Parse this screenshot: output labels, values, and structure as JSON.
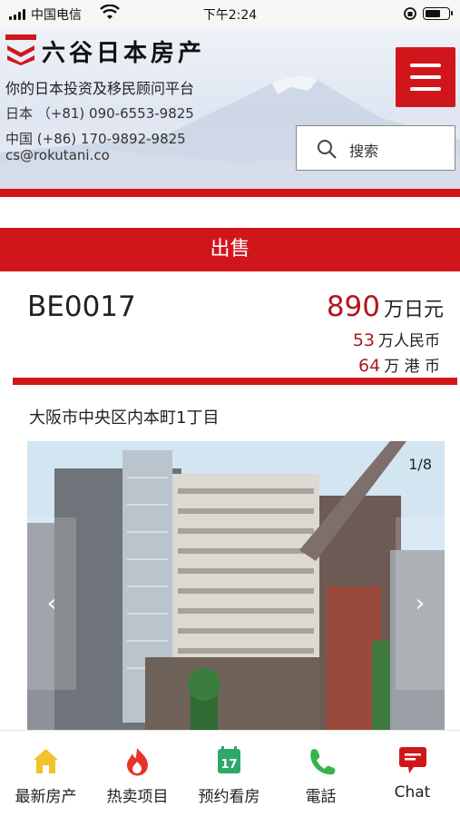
{
  "status_bar": {
    "carrier": "中国电信",
    "time": "下午2:24",
    "battery_level": 0.7
  },
  "header": {
    "logo_text": "六谷日本房产",
    "tagline": "你的日本投资及移民顾问平台",
    "phone_japan": "日本 （+81) 090-6553-9825",
    "phone_china": "中国 (+86) 170-9892-9825",
    "email": "cs@rokutani.co",
    "search_placeholder": "搜索",
    "colors": {
      "brand_red": "#d1161b"
    }
  },
  "listing": {
    "section_label": "出售",
    "property_id": "BE0017",
    "price_value": "890",
    "price_unit": "万日元",
    "price_rmb_value": "53",
    "price_rmb_unit": "万人民币",
    "price_hkd_value": "64",
    "price_hkd_unit": "万 港 币",
    "address": "大阪市中央区内本町1丁目",
    "photo_counter": "1/8"
  },
  "bottom_nav": {
    "items": [
      {
        "label": "最新房产",
        "icon": "home-icon"
      },
      {
        "label": "热卖项目",
        "icon": "fire-icon"
      },
      {
        "label": "预约看房",
        "icon": "calendar-icon",
        "badge": "17"
      },
      {
        "label": "電話",
        "icon": "phone-icon"
      },
      {
        "label": "Chat",
        "icon": "chat-icon"
      }
    ]
  }
}
